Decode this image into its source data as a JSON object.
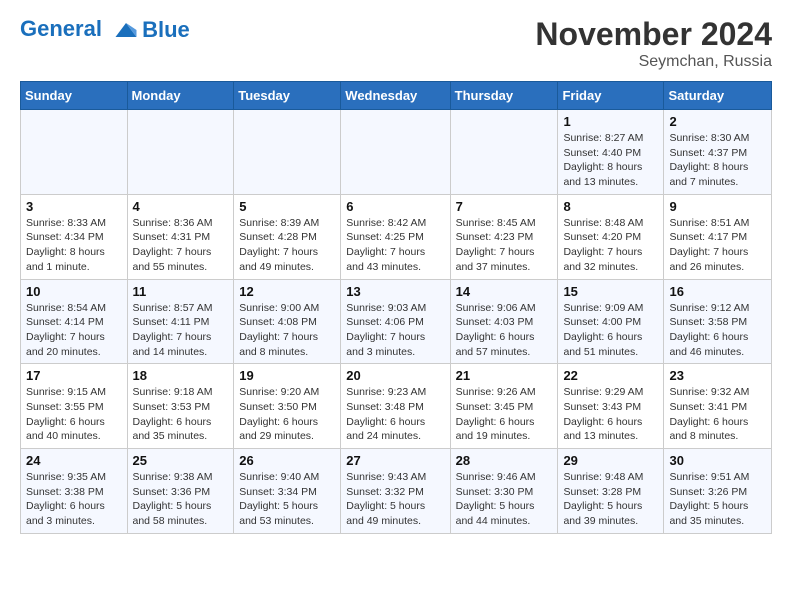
{
  "logo": {
    "line1": "General",
    "line2": "Blue"
  },
  "title": "November 2024",
  "location": "Seymchan, Russia",
  "days_header": [
    "Sunday",
    "Monday",
    "Tuesday",
    "Wednesday",
    "Thursday",
    "Friday",
    "Saturday"
  ],
  "weeks": [
    [
      {
        "day": "",
        "info": ""
      },
      {
        "day": "",
        "info": ""
      },
      {
        "day": "",
        "info": ""
      },
      {
        "day": "",
        "info": ""
      },
      {
        "day": "",
        "info": ""
      },
      {
        "day": "1",
        "info": "Sunrise: 8:27 AM\nSunset: 4:40 PM\nDaylight: 8 hours and 13 minutes."
      },
      {
        "day": "2",
        "info": "Sunrise: 8:30 AM\nSunset: 4:37 PM\nDaylight: 8 hours and 7 minutes."
      }
    ],
    [
      {
        "day": "3",
        "info": "Sunrise: 8:33 AM\nSunset: 4:34 PM\nDaylight: 8 hours and 1 minute."
      },
      {
        "day": "4",
        "info": "Sunrise: 8:36 AM\nSunset: 4:31 PM\nDaylight: 7 hours and 55 minutes."
      },
      {
        "day": "5",
        "info": "Sunrise: 8:39 AM\nSunset: 4:28 PM\nDaylight: 7 hours and 49 minutes."
      },
      {
        "day": "6",
        "info": "Sunrise: 8:42 AM\nSunset: 4:25 PM\nDaylight: 7 hours and 43 minutes."
      },
      {
        "day": "7",
        "info": "Sunrise: 8:45 AM\nSunset: 4:23 PM\nDaylight: 7 hours and 37 minutes."
      },
      {
        "day": "8",
        "info": "Sunrise: 8:48 AM\nSunset: 4:20 PM\nDaylight: 7 hours and 32 minutes."
      },
      {
        "day": "9",
        "info": "Sunrise: 8:51 AM\nSunset: 4:17 PM\nDaylight: 7 hours and 26 minutes."
      }
    ],
    [
      {
        "day": "10",
        "info": "Sunrise: 8:54 AM\nSunset: 4:14 PM\nDaylight: 7 hours and 20 minutes."
      },
      {
        "day": "11",
        "info": "Sunrise: 8:57 AM\nSunset: 4:11 PM\nDaylight: 7 hours and 14 minutes."
      },
      {
        "day": "12",
        "info": "Sunrise: 9:00 AM\nSunset: 4:08 PM\nDaylight: 7 hours and 8 minutes."
      },
      {
        "day": "13",
        "info": "Sunrise: 9:03 AM\nSunset: 4:06 PM\nDaylight: 7 hours and 3 minutes."
      },
      {
        "day": "14",
        "info": "Sunrise: 9:06 AM\nSunset: 4:03 PM\nDaylight: 6 hours and 57 minutes."
      },
      {
        "day": "15",
        "info": "Sunrise: 9:09 AM\nSunset: 4:00 PM\nDaylight: 6 hours and 51 minutes."
      },
      {
        "day": "16",
        "info": "Sunrise: 9:12 AM\nSunset: 3:58 PM\nDaylight: 6 hours and 46 minutes."
      }
    ],
    [
      {
        "day": "17",
        "info": "Sunrise: 9:15 AM\nSunset: 3:55 PM\nDaylight: 6 hours and 40 minutes."
      },
      {
        "day": "18",
        "info": "Sunrise: 9:18 AM\nSunset: 3:53 PM\nDaylight: 6 hours and 35 minutes."
      },
      {
        "day": "19",
        "info": "Sunrise: 9:20 AM\nSunset: 3:50 PM\nDaylight: 6 hours and 29 minutes."
      },
      {
        "day": "20",
        "info": "Sunrise: 9:23 AM\nSunset: 3:48 PM\nDaylight: 6 hours and 24 minutes."
      },
      {
        "day": "21",
        "info": "Sunrise: 9:26 AM\nSunset: 3:45 PM\nDaylight: 6 hours and 19 minutes."
      },
      {
        "day": "22",
        "info": "Sunrise: 9:29 AM\nSunset: 3:43 PM\nDaylight: 6 hours and 13 minutes."
      },
      {
        "day": "23",
        "info": "Sunrise: 9:32 AM\nSunset: 3:41 PM\nDaylight: 6 hours and 8 minutes."
      }
    ],
    [
      {
        "day": "24",
        "info": "Sunrise: 9:35 AM\nSunset: 3:38 PM\nDaylight: 6 hours and 3 minutes."
      },
      {
        "day": "25",
        "info": "Sunrise: 9:38 AM\nSunset: 3:36 PM\nDaylight: 5 hours and 58 minutes."
      },
      {
        "day": "26",
        "info": "Sunrise: 9:40 AM\nSunset: 3:34 PM\nDaylight: 5 hours and 53 minutes."
      },
      {
        "day": "27",
        "info": "Sunrise: 9:43 AM\nSunset: 3:32 PM\nDaylight: 5 hours and 49 minutes."
      },
      {
        "day": "28",
        "info": "Sunrise: 9:46 AM\nSunset: 3:30 PM\nDaylight: 5 hours and 44 minutes."
      },
      {
        "day": "29",
        "info": "Sunrise: 9:48 AM\nSunset: 3:28 PM\nDaylight: 5 hours and 39 minutes."
      },
      {
        "day": "30",
        "info": "Sunrise: 9:51 AM\nSunset: 3:26 PM\nDaylight: 5 hours and 35 minutes."
      }
    ]
  ]
}
